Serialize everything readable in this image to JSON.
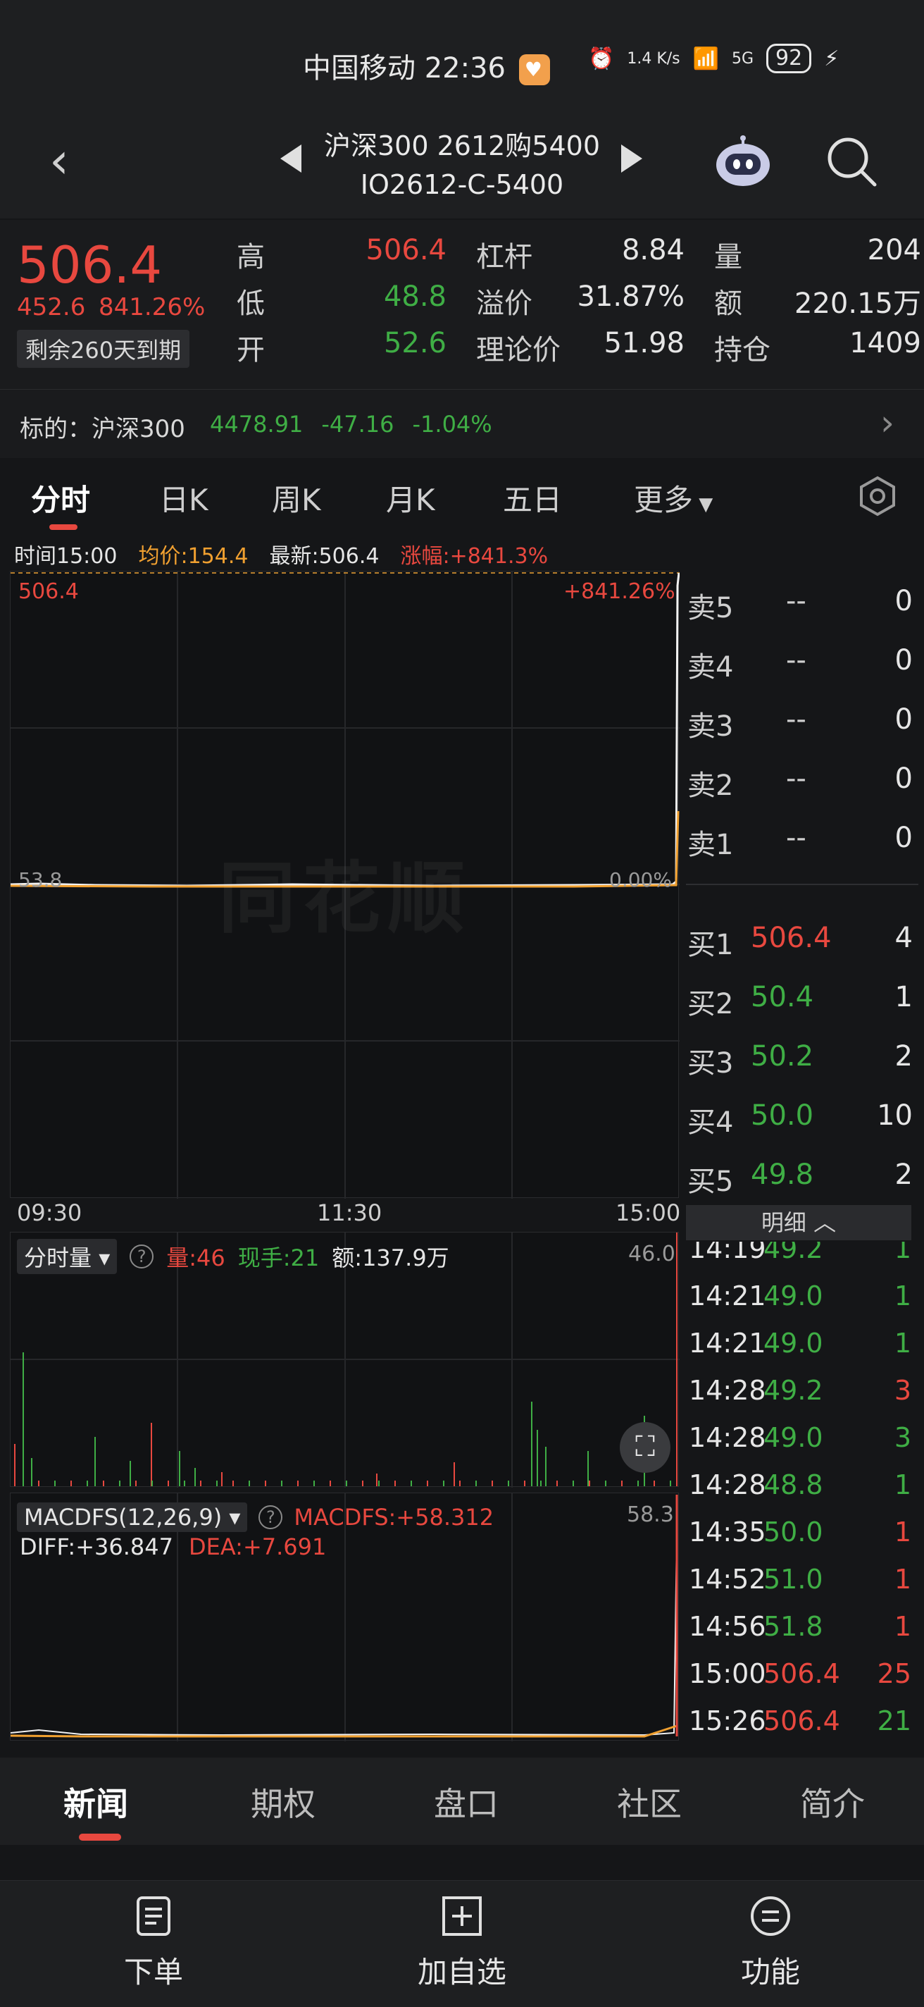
{
  "status": {
    "carrier_time": "中国移动 22:36",
    "net_speed": "1.4 K/s",
    "network": "5G",
    "battery": "92"
  },
  "header": {
    "title": "沪深300 2612购5400",
    "code": "IO2612-C-5400"
  },
  "quote": {
    "last": "506.4",
    "change": "452.6",
    "change_pct": "841.26%",
    "expiry": "剩余260天到期",
    "high_label": "高",
    "high": "506.4",
    "low_label": "低",
    "low": "48.8",
    "open_label": "开",
    "open": "52.6",
    "leverage_label": "杠杆",
    "leverage": "8.84",
    "premium_label": "溢价",
    "premium": "31.87%",
    "theory_label": "理论价",
    "theory": "51.98",
    "volume_label": "量",
    "volume": "204",
    "amount_label": "额",
    "amount": "220.15万",
    "oi_label": "持仓",
    "oi": "1409"
  },
  "underlying": {
    "label": "标的：沪深300",
    "price": "4478.91",
    "change": "-47.16",
    "pct": "-1.04%"
  },
  "tabs": [
    "分时",
    "日K",
    "周K",
    "月K",
    "五日",
    "更多"
  ],
  "info": {
    "time": "时间15:00",
    "avg": "均价:154.4",
    "latest": "最新:506.4",
    "rise": "涨幅:+841.3%"
  },
  "price_chart": {
    "top_left": "506.4",
    "top_right": "+841.26%",
    "base_left": "53.8",
    "base_right": "0.00%",
    "watermark": "同花顺"
  },
  "time_axis": [
    "09:30",
    "11:30",
    "15:00"
  ],
  "volume": {
    "selector": "分时量",
    "vol": "量:46",
    "hand": "现手:21",
    "amt": "额:137.9万",
    "max": "46.0"
  },
  "macd": {
    "selector": "MACDFS(12,26,9)",
    "macdfs": "MACDFS:+58.312",
    "diff": "DIFF:+36.847",
    "dea": "DEA:+7.691",
    "max": "58.3"
  },
  "order_book": {
    "asks": [
      {
        "label": "卖5",
        "price": "--",
        "vol": "0"
      },
      {
        "label": "卖4",
        "price": "--",
        "vol": "0"
      },
      {
        "label": "卖3",
        "price": "--",
        "vol": "0"
      },
      {
        "label": "卖2",
        "price": "--",
        "vol": "0"
      },
      {
        "label": "卖1",
        "price": "--",
        "vol": "0"
      }
    ],
    "bids": [
      {
        "label": "买1",
        "price": "506.4",
        "vol": "4",
        "color": "#e8483f"
      },
      {
        "label": "买2",
        "price": "50.4",
        "vol": "1",
        "color": "#3fae45"
      },
      {
        "label": "买3",
        "price": "50.2",
        "vol": "2",
        "color": "#3fae45"
      },
      {
        "label": "买4",
        "price": "50.0",
        "vol": "10",
        "color": "#3fae45"
      },
      {
        "label": "买5",
        "price": "49.8",
        "vol": "2",
        "color": "#3fae45"
      }
    ]
  },
  "detail": {
    "header": "明细",
    "rows": [
      {
        "t": "14:19",
        "p": "49.2",
        "v": "1",
        "pc": "#3fae45",
        "vc": "#3fae45"
      },
      {
        "t": "14:21",
        "p": "49.0",
        "v": "1",
        "pc": "#3fae45",
        "vc": "#3fae45"
      },
      {
        "t": "14:21",
        "p": "49.0",
        "v": "1",
        "pc": "#3fae45",
        "vc": "#3fae45"
      },
      {
        "t": "14:28",
        "p": "49.2",
        "v": "3",
        "pc": "#3fae45",
        "vc": "#e8483f"
      },
      {
        "t": "14:28",
        "p": "49.0",
        "v": "3",
        "pc": "#3fae45",
        "vc": "#3fae45"
      },
      {
        "t": "14:28",
        "p": "48.8",
        "v": "1",
        "pc": "#3fae45",
        "vc": "#3fae45"
      },
      {
        "t": "14:35",
        "p": "50.0",
        "v": "1",
        "pc": "#3fae45",
        "vc": "#e8483f"
      },
      {
        "t": "14:52",
        "p": "51.0",
        "v": "1",
        "pc": "#3fae45",
        "vc": "#e8483f"
      },
      {
        "t": "14:56",
        "p": "51.8",
        "v": "1",
        "pc": "#3fae45",
        "vc": "#e8483f"
      },
      {
        "t": "15:00",
        "p": "506.4",
        "v": "25",
        "pc": "#e8483f",
        "vc": "#e8483f"
      },
      {
        "t": "15:26",
        "p": "506.4",
        "v": "21",
        "pc": "#e8483f",
        "vc": "#3fae45"
      }
    ]
  },
  "bottom_tabs": [
    "新闻",
    "期权",
    "盘口",
    "社区",
    "简介"
  ],
  "toolbar": {
    "order": "下单",
    "add": "加自选",
    "func": "功能"
  },
  "colors": {
    "up": "#e8483f",
    "down": "#3fae45",
    "avg_line": "#f0a030"
  }
}
